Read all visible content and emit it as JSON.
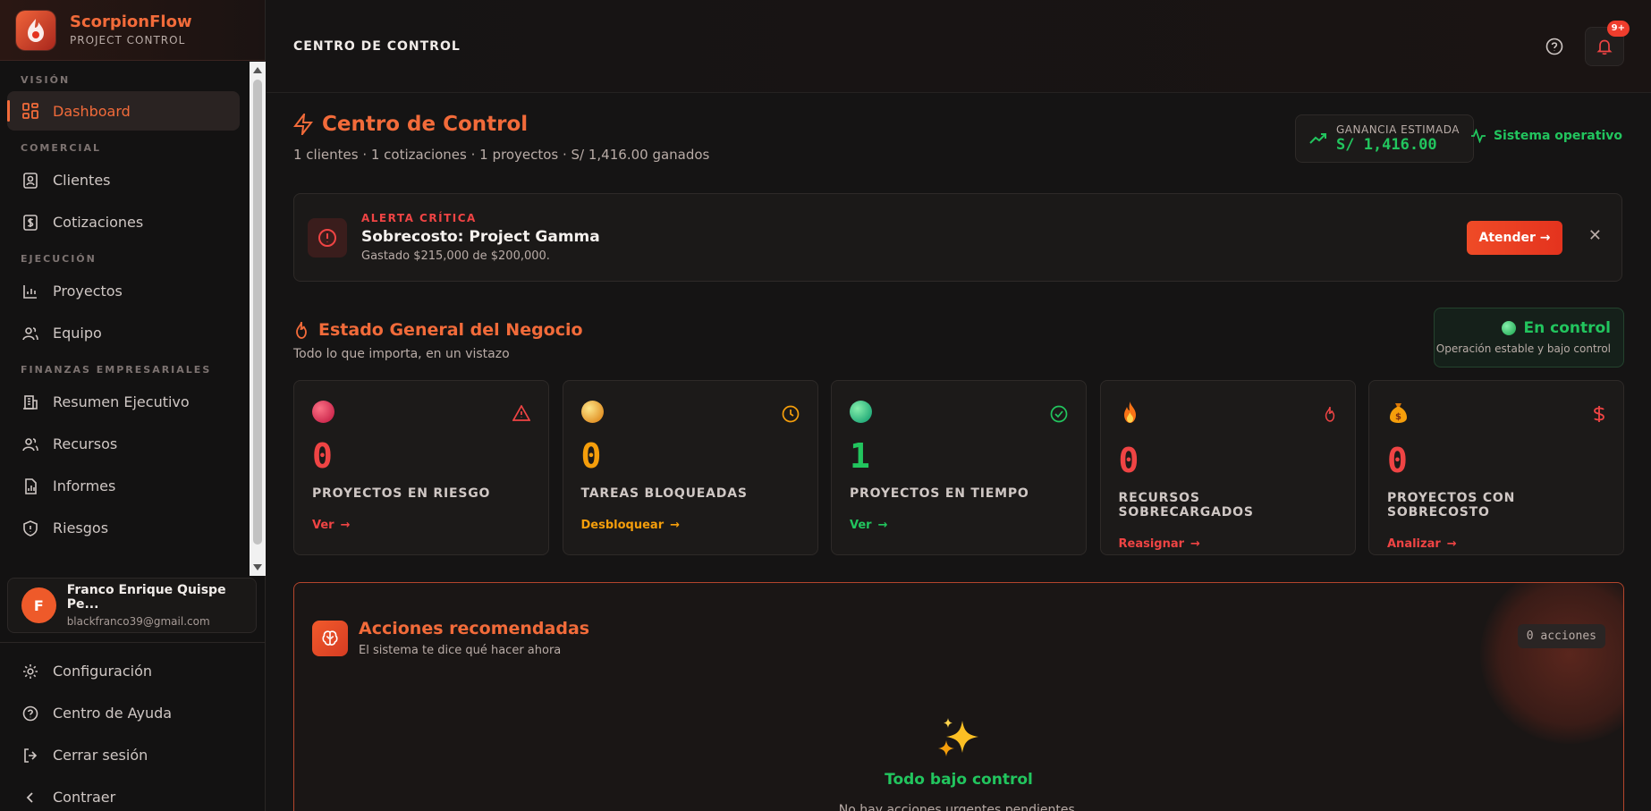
{
  "brand": {
    "name": "ScorpionFlow",
    "subtitle": "PROJECT CONTROL"
  },
  "sidebar": {
    "sections": [
      {
        "title": "VISIÓN",
        "items": [
          {
            "label": "Dashboard",
            "icon": "grid-icon",
            "active": true
          }
        ]
      },
      {
        "title": "COMERCIAL",
        "items": [
          {
            "label": "Clientes",
            "icon": "contacts-icon"
          },
          {
            "label": "Cotizaciones",
            "icon": "invoice-icon"
          }
        ]
      },
      {
        "title": "EJECUCIÓN",
        "items": [
          {
            "label": "Proyectos",
            "icon": "chart-icon"
          },
          {
            "label": "Equipo",
            "icon": "users-icon"
          }
        ]
      },
      {
        "title": "FINANZAS EMPRESARIALES",
        "items": [
          {
            "label": "Resumen Ejecutivo",
            "icon": "building-icon"
          },
          {
            "label": "Recursos",
            "icon": "users-icon"
          },
          {
            "label": "Informes",
            "icon": "report-icon"
          },
          {
            "label": "Riesgos",
            "icon": "shield-icon"
          }
        ]
      }
    ],
    "user": {
      "initial": "F",
      "name": "Franco Enrique Quispe Pe...",
      "email": "blackfranco39@gmail.com"
    },
    "bottom": [
      {
        "label": "Configuración",
        "icon": "gear-icon"
      },
      {
        "label": "Centro de Ayuda",
        "icon": "help-icon"
      },
      {
        "label": "Cerrar sesión",
        "icon": "logout-icon"
      },
      {
        "label": "Contraer",
        "icon": "chevron-left-icon"
      }
    ]
  },
  "topbar": {
    "title": "CENTRO DE CONTROL",
    "badge": "9+"
  },
  "hero": {
    "title": "Centro de Control",
    "subtitle": "1 clientes · 1 cotizaciones · 1 proyectos · S/ 1,416.00 ganados",
    "gain_label": "GANANCIA ESTIMADA",
    "gain_value": "S/ 1,416.00",
    "system_status": "Sistema operativo"
  },
  "alert": {
    "kicker": "ALERTA CRÍTICA",
    "title": "Sobrecosto: Project Gamma",
    "description": "Gastado $215,000 de $200,000.",
    "button": "Atender →"
  },
  "state": {
    "title": "Estado General del Negocio",
    "subtitle": "Todo lo que importa, en un vistazo",
    "control_title": "En control",
    "control_sub": "Operación estable y bajo control"
  },
  "cards": [
    {
      "value": "0",
      "label": "PROYECTOS EN RIESGO",
      "link": "Ver",
      "color": "#ef4444",
      "ball": "#e11d48",
      "corner_icon": "warning-icon"
    },
    {
      "value": "0",
      "label": "TAREAS BLOQUEADAS",
      "link": "Desbloquear",
      "color": "#f59e0b",
      "ball": "#f2b52b",
      "corner_icon": "clock-icon"
    },
    {
      "value": "1",
      "label": "PROYECTOS EN TIEMPO",
      "link": "Ver",
      "color": "#22c55e",
      "ball": "#22c55e",
      "corner_icon": "check-circle-icon"
    },
    {
      "value": "0",
      "label": "RECURSOS SOBRECARGADOS",
      "link": "Reasignar",
      "color": "#ef4444",
      "ball": "fire",
      "corner_icon": "flame-icon"
    },
    {
      "value": "0",
      "label": "PROYECTOS CON SOBRECOSTO",
      "link": "Analizar",
      "color": "#ef4444",
      "ball": "money",
      "corner_icon": "dollar-icon"
    }
  ],
  "actions": {
    "title": "Acciones recomendadas",
    "subtitle": "El sistema te dice qué hacer ahora",
    "count": "0 acciones",
    "empty_title": "Todo bajo control",
    "empty_sub": "No hay acciones urgentes pendientes."
  }
}
